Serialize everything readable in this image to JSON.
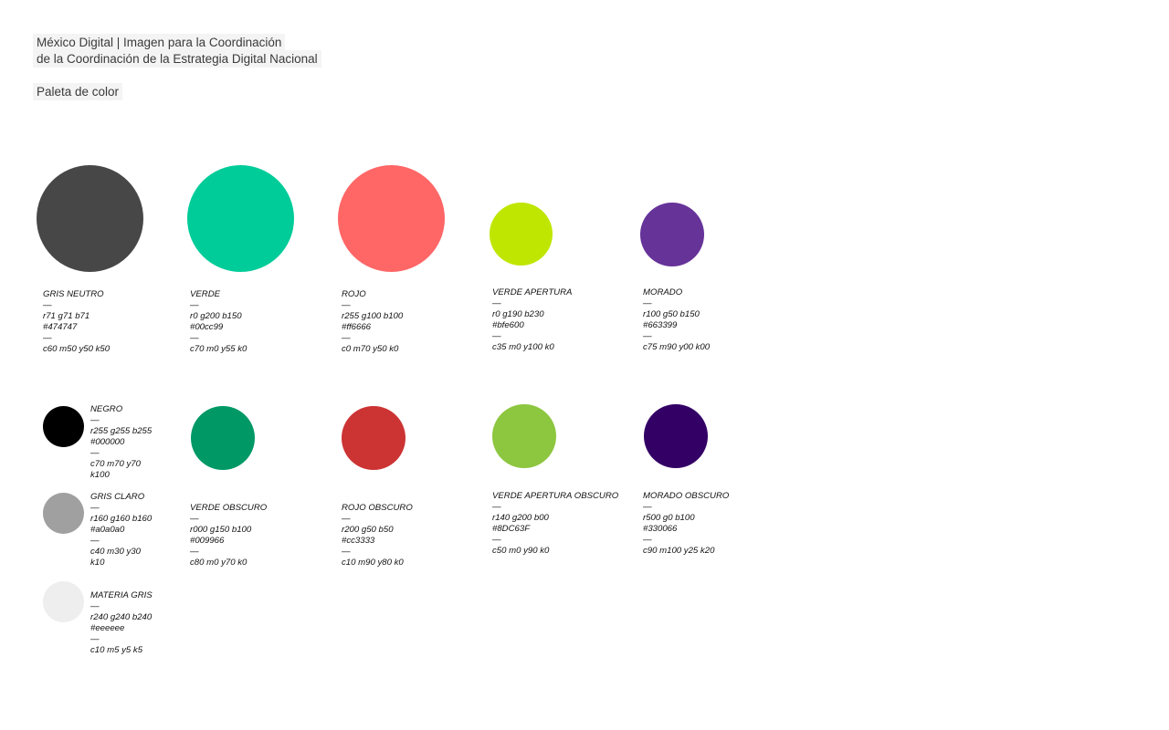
{
  "header": {
    "line1": "México Digital | Imagen para la Coordinación",
    "line2": "de la Coordinación de la Estrategia Digital Nacional",
    "section_title": "Paleta de color"
  },
  "dash": "—",
  "swatches": [
    {
      "id": "gris-neutro",
      "name": "GRIS NEUTRO",
      "rgb": "r71 g71 b71",
      "hex": "#474747",
      "cmyk": "c60 m50 y50 k50",
      "color": "#474747"
    },
    {
      "id": "verde",
      "name": "VERDE",
      "rgb": "r0 g200 b150",
      "hex": "#00cc99",
      "cmyk": "c70 m0 y55 k0",
      "color": "#00cc99"
    },
    {
      "id": "rojo",
      "name": "ROJO",
      "rgb": "r255 g100 b100",
      "hex": "#ff6666",
      "cmyk": "c0 m70 y50 k0",
      "color": "#ff6666"
    },
    {
      "id": "verde-apertura",
      "name": "VERDE APERTURA",
      "rgb": "r0 g190 b230",
      "hex": "#bfe600",
      "cmyk": "c35 m0 y100 k0",
      "color": "#bfe600"
    },
    {
      "id": "morado",
      "name": "MORADO",
      "rgb": "r100 g50 b150",
      "hex": "#663399",
      "cmyk": "c75 m90 y00 k00",
      "color": "#663399"
    },
    {
      "id": "negro",
      "name": "NEGRO",
      "rgb": "r255 g255 b255",
      "hex": "#000000",
      "cmyk1": "c70 m70 y70",
      "cmyk2": "k100",
      "color": "#000000"
    },
    {
      "id": "gris-claro",
      "name": "GRIS CLARO",
      "rgb": "r160 g160 b160",
      "hex": "#a0a0a0",
      "cmyk1": "c40 m30 y30",
      "cmyk2": "k10",
      "color": "#a0a0a0"
    },
    {
      "id": "materia-gris",
      "name": "MATERIA GRIS",
      "rgb": "r240 g240 b240",
      "hex": "#eeeeee",
      "cmyk": "c10 m5 y5 k5",
      "color": "#eeeeee"
    },
    {
      "id": "verde-obscuro",
      "name": "VERDE OBSCURO",
      "rgb": "r000 g150 b100",
      "hex": "#009966",
      "cmyk": "c80 m0 y70 k0",
      "color": "#009966"
    },
    {
      "id": "rojo-obscuro",
      "name": "ROJO OBSCURO",
      "rgb": "r200 g50 b50",
      "hex": "#cc3333",
      "cmyk": "c10 m90 y80 k0",
      "color": "#cc3333"
    },
    {
      "id": "verde-apertura-obscuro",
      "name": "VERDE APERTURA OBSCURO",
      "rgb": "r140 g200 b00",
      "hex": "#8DC63F",
      "cmyk": "c50 m0 y90 k0",
      "color": "#8dc63f"
    },
    {
      "id": "morado-obscuro",
      "name": "MORADO OBSCURO",
      "rgb": "r500 g0 b100",
      "hex": "#330066",
      "cmyk": "c90 m100 y25 k20",
      "color": "#330066"
    }
  ]
}
